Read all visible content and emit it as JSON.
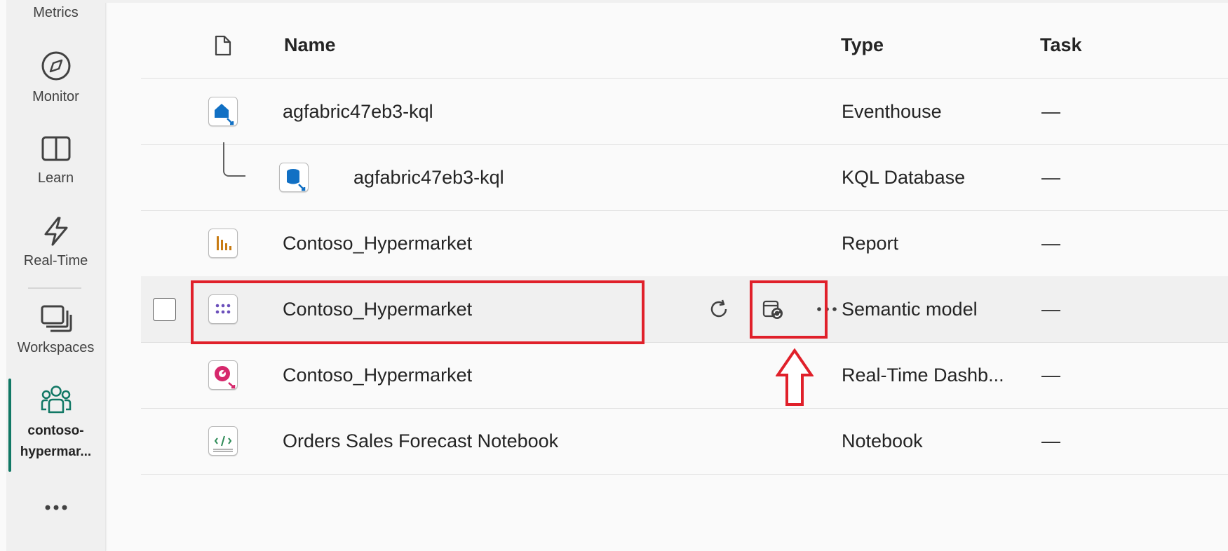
{
  "rail": {
    "metrics_label": "Metrics",
    "monitor_label": "Monitor",
    "learn_label": "Learn",
    "realtime_label": "Real-Time",
    "workspaces_label": "Workspaces",
    "workspace_line1": "contoso-",
    "workspace_line2": "hypermar...",
    "more_label": "..."
  },
  "table": {
    "headers": {
      "name": "Name",
      "type": "Type",
      "task": "Task"
    },
    "rows": [
      {
        "name": "agfabric47eb3-kql",
        "type": "Eventhouse",
        "task": "—",
        "icon": "eventhouse-icon"
      },
      {
        "name": "agfabric47eb3-kql",
        "type": "KQL Database",
        "task": "—",
        "icon": "kql-database-icon"
      },
      {
        "name": "Contoso_Hypermarket",
        "type": "Report",
        "task": "—",
        "icon": "report-icon"
      },
      {
        "name": "Contoso_Hypermarket",
        "type": "Semantic model",
        "task": "—",
        "icon": "semantic-model-icon"
      },
      {
        "name": "Contoso_Hypermarket",
        "type": "Real-Time Dashb...",
        "task": "—",
        "icon": "realtime-dashboard-icon"
      },
      {
        "name": "Orders Sales Forecast Notebook",
        "type": "Notebook",
        "task": "—",
        "icon": "notebook-icon"
      }
    ],
    "hover_actions": {
      "refresh": "refresh-icon",
      "schedule": "schedule-refresh-icon",
      "more": "more-options-icon"
    }
  },
  "annotation_color": "#e0202a",
  "accent_color": "#117865"
}
